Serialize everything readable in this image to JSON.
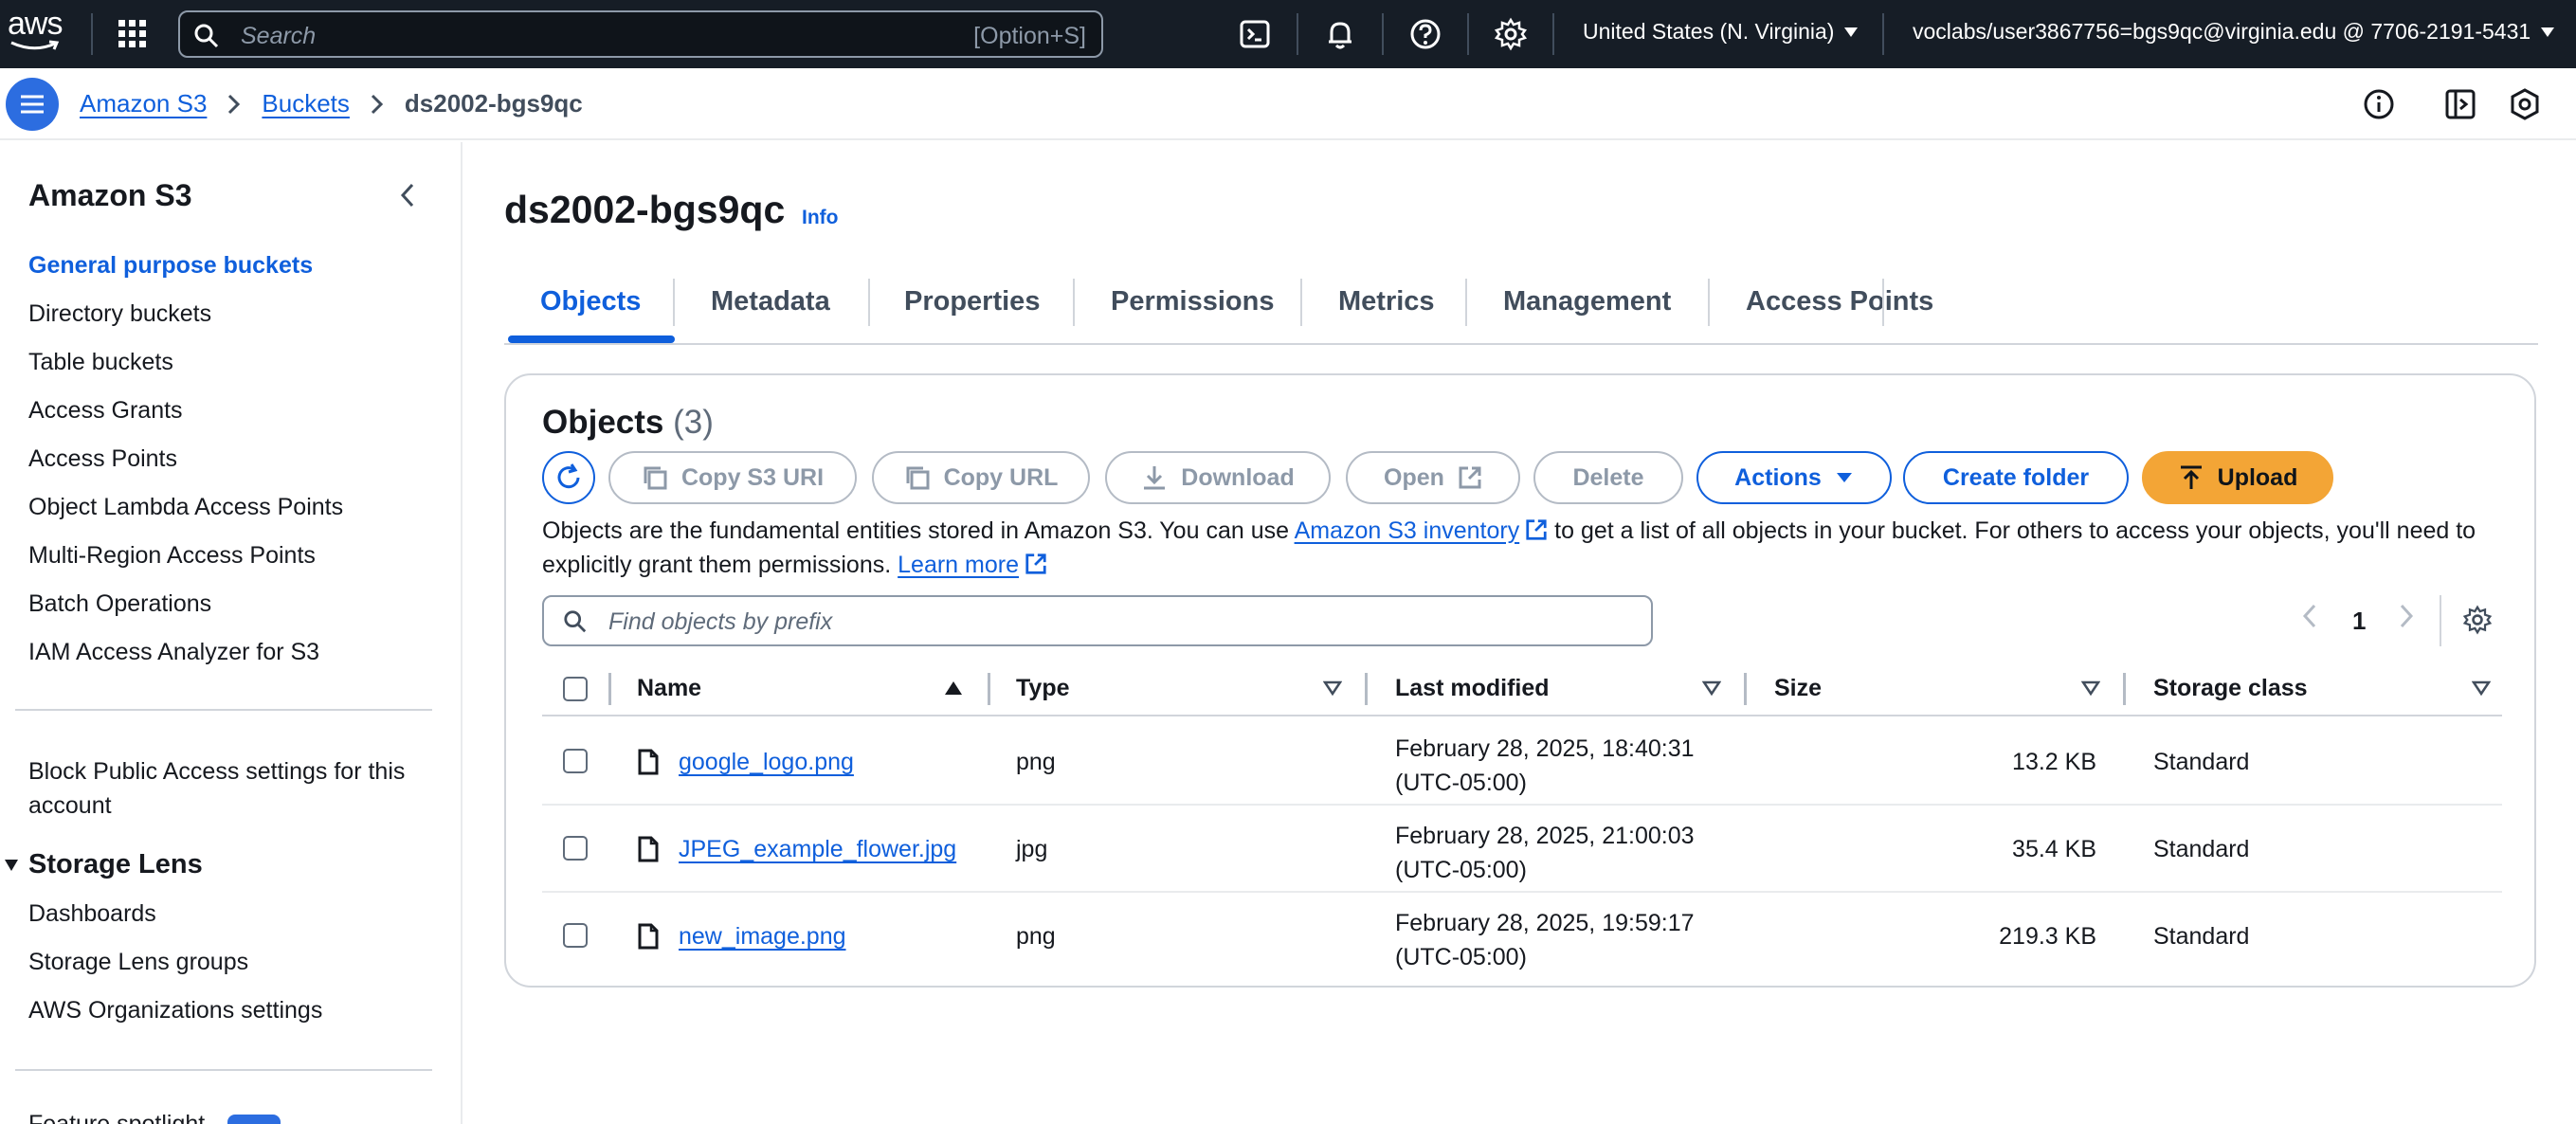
{
  "topnav": {
    "logo_text": "aws",
    "search_placeholder": "Search",
    "search_shortcut": "[Option+S]",
    "region": "United States (N. Virginia)",
    "account": "voclabs/user3867756=bgs9qc@virginia.edu @ 7706-2191-5431"
  },
  "breadcrumb": {
    "items": [
      "Amazon S3",
      "Buckets"
    ],
    "current": "ds2002-bgs9qc"
  },
  "sidebar": {
    "title": "Amazon S3",
    "items": [
      "General purpose buckets",
      "Directory buckets",
      "Table buckets",
      "Access Grants",
      "Access Points",
      "Object Lambda Access Points",
      "Multi-Region Access Points",
      "Batch Operations",
      "IAM Access Analyzer for S3"
    ],
    "block_public_access": "Block Public Access settings for this account",
    "storage_lens": {
      "heading": "Storage Lens",
      "items": [
        "Dashboards",
        "Storage Lens groups",
        "AWS Organizations settings"
      ]
    },
    "cut_item": "Feature spotlight"
  },
  "bucket": {
    "name": "ds2002-bgs9qc",
    "info_label": "Info"
  },
  "tabs": [
    "Objects",
    "Metadata",
    "Properties",
    "Permissions",
    "Metrics",
    "Management",
    "Access Points"
  ],
  "objects_panel": {
    "heading": "Objects",
    "count": "(3)",
    "buttons": {
      "copy_s3_uri": "Copy S3 URI",
      "copy_url": "Copy URL",
      "download": "Download",
      "open": "Open",
      "delete": "Delete",
      "actions": "Actions",
      "create_folder": "Create folder",
      "upload": "Upload"
    },
    "description": {
      "part1": "Objects are the fundamental entities stored in Amazon S3. You can use ",
      "link1": "Amazon S3 inventory",
      "part2": " to get a list of all objects in your bucket. For others to access your objects, you'll need to explicitly grant them permissions. ",
      "link2": "Learn more"
    },
    "filter_placeholder": "Find objects by prefix",
    "page_number": "1",
    "columns": [
      "Name",
      "Type",
      "Last modified",
      "Size",
      "Storage class"
    ],
    "rows": [
      {
        "name": "google_logo.png",
        "type": "png",
        "modified_line1": "February 28, 2025, 18:40:31",
        "modified_line2": "(UTC-05:00)",
        "size": "13.2 KB",
        "storage_class": "Standard"
      },
      {
        "name": "JPEG_example_flower.jpg",
        "type": "jpg",
        "modified_line1": "February 28, 2025, 21:00:03",
        "modified_line2": "(UTC-05:00)",
        "size": "35.4 KB",
        "storage_class": "Standard"
      },
      {
        "name": "new_image.png",
        "type": "png",
        "modified_line1": "February 28, 2025, 19:59:17",
        "modified_line2": "(UTC-05:00)",
        "size": "219.3 KB",
        "storage_class": "Standard"
      }
    ]
  },
  "colors": {
    "nav_bg": "#161d26",
    "link_blue": "#0f5fdc",
    "upload_orange": "#f3a536"
  },
  "icons": [
    "apps-grid-icon",
    "search-icon",
    "cloudshell-icon",
    "bell-icon",
    "help-icon",
    "gear-icon",
    "caret-down-icon",
    "menu-icon",
    "chevron-right-icon",
    "info-circle-icon",
    "panel-icon",
    "shield-icon",
    "chevron-left-icon",
    "refresh-icon",
    "copy-icon",
    "download-icon",
    "external-link-icon",
    "upload-icon",
    "file-icon",
    "sort-asc-icon",
    "sort-desc-icon"
  ]
}
